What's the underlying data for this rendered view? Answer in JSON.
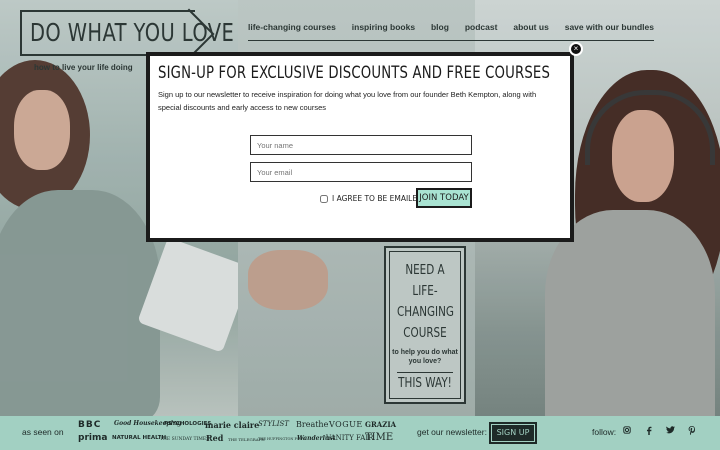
{
  "header": {
    "logo_text": "DO WHAT YOU LOVE",
    "tagline": "how to live your life doing"
  },
  "nav": {
    "items": [
      "life-changing courses",
      "inspiring books",
      "blog",
      "podcast",
      "about us",
      "save with our bundles"
    ]
  },
  "course_card": {
    "title": "NEED A LIFE-CHANGING COURSE",
    "subtitle": "to help you do what you love?",
    "cta": "THIS WAY!"
  },
  "modal": {
    "title": "SIGN-UP FOR EXCLUSIVE DISCOUNTS AND FREE COURSES",
    "description": "Sign up to our newsletter to receive inspiration for doing what you love from our founder Beth Kempton, along with special discounts and early access to new courses",
    "name_placeholder": "Your name",
    "email_placeholder": "Your email",
    "agree_label": "I agree to be emailed",
    "join_label": "JOIN TODAY",
    "close_glyph": "×"
  },
  "footer": {
    "as_seen_on": "as seen on",
    "publications": [
      "BBC",
      "Good Housekeeping",
      "PSYCHOLOGIES",
      "marie claire",
      "STYLIST",
      "Breathe",
      "VOGUE",
      "GRAZIA",
      "prima",
      "NATURAL HEALTH",
      "THE SUNDAY TIMES",
      "Red",
      "THE TELEGRAPH",
      "THE HUFFINGTON POST",
      "Wanderlust",
      "VANITY FAIR",
      "TIME"
    ],
    "newsletter_label": "get our newsletter:",
    "signup_label": "SIGN UP",
    "follow_label": "follow:",
    "social_icons": [
      "instagram-icon",
      "facebook-icon",
      "twitter-icon",
      "pinterest-icon"
    ]
  },
  "colors": {
    "accent": "#a2d0c2",
    "dark": "#1e2a28",
    "button": "#a9e3d2"
  }
}
